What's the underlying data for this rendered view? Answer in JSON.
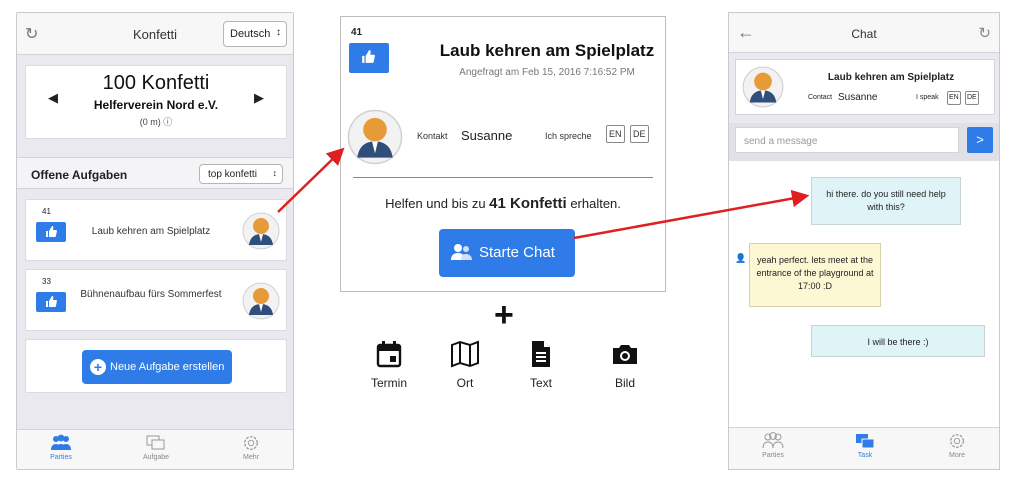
{
  "phone1": {
    "title": "Konfetti",
    "language": "Deutsch",
    "konfetti_amount": "100 Konfetti",
    "organization": "Helferverein Nord e.V.",
    "distance": "(0 m) ⓘ",
    "tasks_title": "Offene Aufgaben",
    "sort_value": "top konfetti",
    "tasks": [
      {
        "count": "41",
        "label": "Laub kehren am Spielplatz"
      },
      {
        "count": "33",
        "label": "Bühnenaufbau fürs Sommerfest"
      }
    ],
    "new_task_label": "Neue Aufgabe erstellen",
    "tabs": [
      {
        "label": "Parties",
        "icon": "group-icon"
      },
      {
        "label": "Aufgabe",
        "icon": "chat-icon"
      },
      {
        "label": "Mehr",
        "icon": "gear-icon"
      }
    ]
  },
  "middle": {
    "count": "41",
    "title": "Laub kehren am Spielplatz",
    "date": "Angefragt am Feb 15, 2016 7:16:52 PM",
    "contact_label": "Kontakt",
    "contact_name": "Susanne",
    "speak_label": "Ich spreche",
    "lang_en": "EN",
    "lang_de": "DE",
    "help_prefix": "Helfen und bis zu",
    "help_amount": "41 Konfetti",
    "help_suffix": "erhalten.",
    "chat_button": "Starte Chat"
  },
  "attachments": {
    "plus": "+",
    "items": [
      {
        "label": "Termin",
        "icon": "calendar-icon"
      },
      {
        "label": "Ort",
        "icon": "map-icon"
      },
      {
        "label": "Text",
        "icon": "document-icon"
      },
      {
        "label": "Bild",
        "icon": "camera-icon"
      }
    ]
  },
  "phone3": {
    "title": "Chat",
    "task_title": "Laub kehren am Spielplatz",
    "contact_label": "Contact",
    "contact_name": "Susanne",
    "speak_label": "I speak",
    "lang_en": "EN",
    "lang_de": "DE",
    "input_placeholder": "send a message",
    "send_label": ">",
    "messages": [
      {
        "from": "me",
        "text": "hi there. do you still need help with this?"
      },
      {
        "from": "them",
        "text": "yeah perfect. lets meet at the entrance of the playground at 17:00 :D"
      },
      {
        "from": "me",
        "text": "I will be there :)"
      }
    ],
    "tabs": [
      {
        "label": "Parties",
        "icon": "group-icon"
      },
      {
        "label": "Task",
        "icon": "chat-icon"
      },
      {
        "label": "More",
        "icon": "gear-icon"
      }
    ]
  },
  "colors": {
    "accent": "#2f7ce8",
    "arrow": "#e02020"
  }
}
